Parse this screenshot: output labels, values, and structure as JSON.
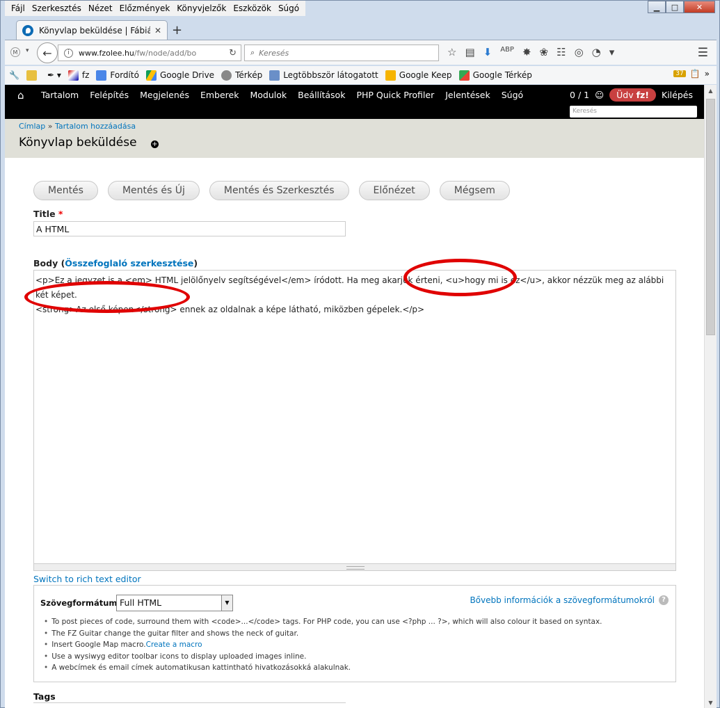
{
  "browser": {
    "menu": [
      "Fájl",
      "Szerkesztés",
      "Nézet",
      "Előzmények",
      "Könyvjelzők",
      "Eszközök",
      "Súgó"
    ],
    "tab_title": "Könyvlap beküldése | Fábiá...",
    "url_domain": "www.fzolee.hu",
    "url_path": "/fw/node/add/bo",
    "search_placeholder": "Keresés",
    "bookmarks": [
      "fz",
      "Fordító",
      "Google Drive",
      "Térkép",
      "Legtöbbször látogatott",
      "Google Keep",
      "Google Térkép"
    ],
    "addon_badge": "37",
    "colors": {
      "tab_favicon": "#0d6bb4",
      "window": "#cfdcec"
    }
  },
  "toolbar": {
    "menu": [
      "Tartalom",
      "Felépítés",
      "Megjelenés",
      "Emberek",
      "Modulok",
      "Beállítások",
      "PHP Quick Profiler",
      "Jelentések",
      "Súgó"
    ],
    "users": "0 / 1",
    "greeting_prefix": "Üdv",
    "greeting_user": "fz!",
    "logout": "Kilépés",
    "search_placeholder": "Keresés",
    "colors": {
      "bg": "#000000",
      "greeting": "#c84040"
    }
  },
  "page": {
    "breadcrumb": [
      "Címlap",
      "Tartalom hozzáadása"
    ],
    "breadcrumb_sep": "»",
    "title": "Könyvlap beküldése"
  },
  "form": {
    "buttons": [
      "Mentés",
      "Mentés és Új",
      "Mentés és Szerkesztés",
      "Előnézet",
      "Mégsem"
    ],
    "title_label": "Title",
    "required_mark": "*",
    "title_value": "A HTML",
    "body_label": "Body",
    "body_summary_link": "Összefoglaló szerkesztése",
    "body_lines": [
      "<p>Ez a jegyzet is a <em> HTML jelölőnyelv segítségével</em> íródott. Ha meg akarjuk érteni, <u>hogy mi is ez</u>, akkor nézzük meg az alábbi két képet.",
      "<strong>Az első képen</strong> ennek az oldalnak a képe látható, miközben gépelek.</p>"
    ],
    "switch_editor": "Switch to rich text editor",
    "format_label": "Szövegformátum",
    "format_value": "Full HTML",
    "format_info_link": "Bővebb információk a szövegformátumokról",
    "tips": [
      "To post pieces of code, surround them with <code>...</code> tags. For PHP code, you can use <?php ... ?>, which will also colour it based on syntax.",
      "The FZ Guitar change the guitar filter and shows the neck of guitar.",
      "Use a wysiwyg editor toolbar icons to display uploaded images inline.",
      "A webcímek és email címek automatikusan kattintható hivatkozásokká alakulnak."
    ],
    "tip_macro_text": "Insert Google Map macro.",
    "tip_macro_link": "Create a macro",
    "tags_label": "Tags",
    "annotation_color": "#e00000"
  }
}
